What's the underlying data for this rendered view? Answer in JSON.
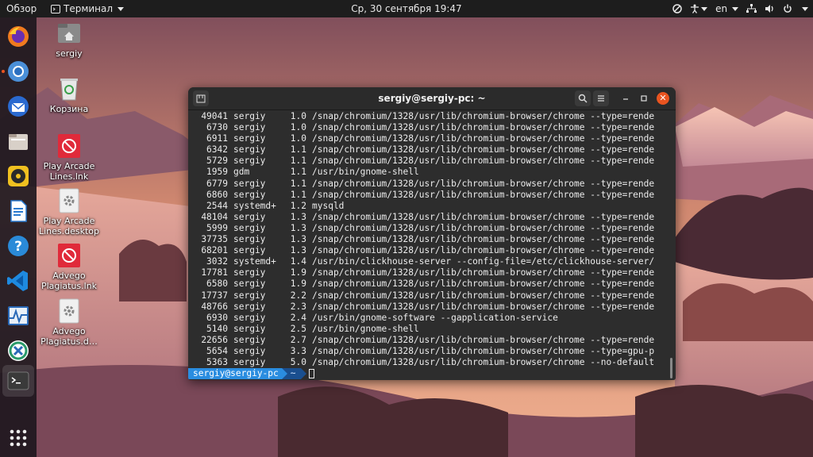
{
  "topbar": {
    "activities": "Обзор",
    "app_menu": "Терминал",
    "clock": "Ср, 30 сентября  19:47",
    "keyboard_layout": "en"
  },
  "dock": {
    "items": [
      {
        "name": "firefox",
        "icon": "firefox-icon"
      },
      {
        "name": "chromium",
        "icon": "chromium-icon",
        "running": true
      },
      {
        "name": "thunderbird",
        "icon": "thunderbird-icon"
      },
      {
        "name": "files",
        "icon": "files-icon"
      },
      {
        "name": "rhythmbox",
        "icon": "rhythmbox-icon"
      },
      {
        "name": "writer",
        "icon": "libreoffice-writer-icon"
      },
      {
        "name": "help",
        "icon": "help-icon"
      },
      {
        "name": "vscode",
        "icon": "vscode-icon"
      },
      {
        "name": "system-monitor",
        "icon": "system-monitor-icon"
      },
      {
        "name": "software",
        "icon": "software-icon"
      },
      {
        "name": "terminal",
        "icon": "terminal-icon",
        "active": true
      },
      {
        "name": "show-applications",
        "icon": "grid-icon"
      }
    ]
  },
  "desktop": {
    "icons": [
      {
        "label": "sergiy",
        "icon": "home-folder-icon"
      },
      {
        "label": "Корзина",
        "icon": "trash-icon"
      },
      {
        "label": "Play Arcade Lines.lnk",
        "icon": "broken-link-icon"
      },
      {
        "label": "Play Arcade Lines.desktop",
        "icon": "settings-file-icon"
      },
      {
        "label": "Advego Plagiatus.lnk",
        "icon": "broken-link-icon"
      },
      {
        "label": "Advego Plagiatus.d…",
        "icon": "settings-file-icon"
      }
    ]
  },
  "terminal": {
    "title": "sergiy@sergiy-pc: ~",
    "rows": [
      {
        "pid": "49041",
        "user": "sergiy",
        "mem": "1.0",
        "cmd": "/snap/chromium/1328/usr/lib/chromium-browser/chrome --type=rende"
      },
      {
        "pid": "6730",
        "user": "sergiy",
        "mem": "1.0",
        "cmd": "/snap/chromium/1328/usr/lib/chromium-browser/chrome --type=rende"
      },
      {
        "pid": "6911",
        "user": "sergiy",
        "mem": "1.0",
        "cmd": "/snap/chromium/1328/usr/lib/chromium-browser/chrome --type=rende"
      },
      {
        "pid": "6342",
        "user": "sergiy",
        "mem": "1.1",
        "cmd": "/snap/chromium/1328/usr/lib/chromium-browser/chrome --type=rende"
      },
      {
        "pid": "5729",
        "user": "sergiy",
        "mem": "1.1",
        "cmd": "/snap/chromium/1328/usr/lib/chromium-browser/chrome --type=rende"
      },
      {
        "pid": "1959",
        "user": "gdm",
        "mem": "1.1",
        "cmd": "/usr/bin/gnome-shell"
      },
      {
        "pid": "6779",
        "user": "sergiy",
        "mem": "1.1",
        "cmd": "/snap/chromium/1328/usr/lib/chromium-browser/chrome --type=rende"
      },
      {
        "pid": "6860",
        "user": "sergiy",
        "mem": "1.1",
        "cmd": "/snap/chromium/1328/usr/lib/chromium-browser/chrome --type=rende"
      },
      {
        "pid": "2544",
        "user": "systemd+",
        "mem": "1.2",
        "cmd": "mysqld"
      },
      {
        "pid": "48104",
        "user": "sergiy",
        "mem": "1.3",
        "cmd": "/snap/chromium/1328/usr/lib/chromium-browser/chrome --type=rende"
      },
      {
        "pid": "5999",
        "user": "sergiy",
        "mem": "1.3",
        "cmd": "/snap/chromium/1328/usr/lib/chromium-browser/chrome --type=rende"
      },
      {
        "pid": "37735",
        "user": "sergiy",
        "mem": "1.3",
        "cmd": "/snap/chromium/1328/usr/lib/chromium-browser/chrome --type=rende"
      },
      {
        "pid": "68201",
        "user": "sergiy",
        "mem": "1.3",
        "cmd": "/snap/chromium/1328/usr/lib/chromium-browser/chrome --type=rende"
      },
      {
        "pid": "3032",
        "user": "systemd+",
        "mem": "1.4",
        "cmd": "/usr/bin/clickhouse-server --config-file=/etc/clickhouse-server/"
      },
      {
        "pid": "17781",
        "user": "sergiy",
        "mem": "1.9",
        "cmd": "/snap/chromium/1328/usr/lib/chromium-browser/chrome --type=rende"
      },
      {
        "pid": "6580",
        "user": "sergiy",
        "mem": "1.9",
        "cmd": "/snap/chromium/1328/usr/lib/chromium-browser/chrome --type=rende"
      },
      {
        "pid": "17737",
        "user": "sergiy",
        "mem": "2.2",
        "cmd": "/snap/chromium/1328/usr/lib/chromium-browser/chrome --type=rende"
      },
      {
        "pid": "48766",
        "user": "sergiy",
        "mem": "2.3",
        "cmd": "/snap/chromium/1328/usr/lib/chromium-browser/chrome --type=rende"
      },
      {
        "pid": "6930",
        "user": "sergiy",
        "mem": "2.4",
        "cmd": "/usr/bin/gnome-software --gapplication-service"
      },
      {
        "pid": "5140",
        "user": "sergiy",
        "mem": "2.5",
        "cmd": "/usr/bin/gnome-shell"
      },
      {
        "pid": "22656",
        "user": "sergiy",
        "mem": "2.7",
        "cmd": "/snap/chromium/1328/usr/lib/chromium-browser/chrome --type=rende"
      },
      {
        "pid": "5654",
        "user": "sergiy",
        "mem": "3.3",
        "cmd": "/snap/chromium/1328/usr/lib/chromium-browser/chrome --type=gpu-p"
      },
      {
        "pid": "5363",
        "user": "sergiy",
        "mem": "5.0",
        "cmd": "/snap/chromium/1328/usr/lib/chromium-browser/chrome --no-default"
      }
    ],
    "prompt": {
      "user_host": "sergiy@sergiy-pc",
      "dir": "~"
    }
  },
  "colors": {
    "accent": "#e95420",
    "prompt_user_bg": "#2a8de0",
    "prompt_dir_bg": "#1a4f8f",
    "terminal_bg": "#2d2d2d"
  }
}
